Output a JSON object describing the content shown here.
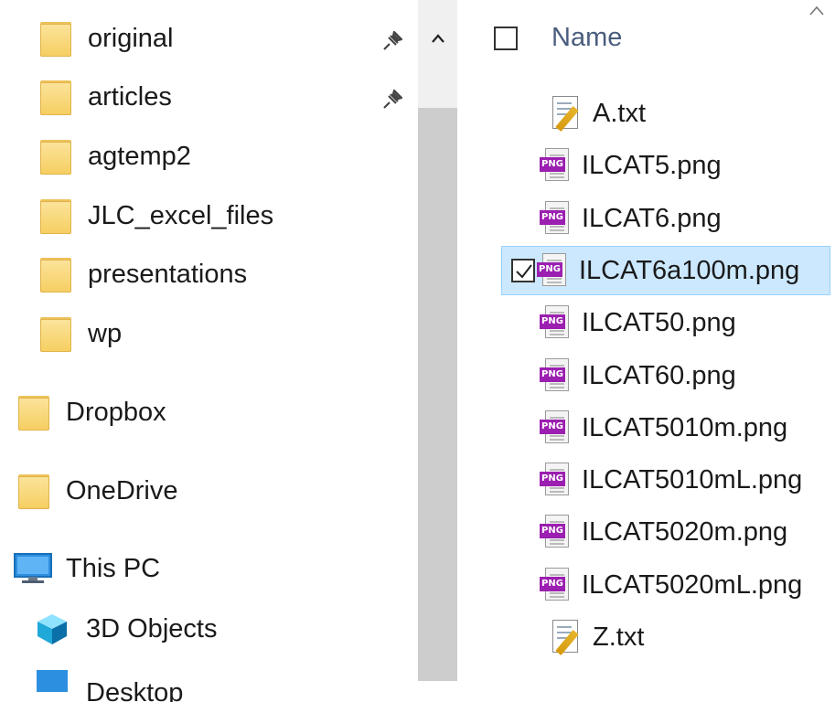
{
  "nav": {
    "pinned_folders": [
      {
        "label": "original",
        "pinned": true
      },
      {
        "label": "articles",
        "pinned": true
      },
      {
        "label": "agtemp2",
        "pinned": false
      },
      {
        "label": "JLC_excel_files",
        "pinned": false
      },
      {
        "label": "presentations",
        "pinned": false
      },
      {
        "label": "wp",
        "pinned": false
      }
    ],
    "dropbox": "Dropbox",
    "onedrive": "OneDrive",
    "this_pc": "This PC",
    "objects_3d": "3D Objects",
    "desktop_partial": "Desktop"
  },
  "header": {
    "name_column": "Name"
  },
  "files": [
    {
      "name": "A.txt",
      "type": "txt",
      "selected": false
    },
    {
      "name": "ILCAT5.png",
      "type": "png",
      "selected": false
    },
    {
      "name": "ILCAT6.png",
      "type": "png",
      "selected": false
    },
    {
      "name": "ILCAT6a100m.png",
      "type": "png",
      "selected": true
    },
    {
      "name": "ILCAT50.png",
      "type": "png",
      "selected": false
    },
    {
      "name": "ILCAT60.png",
      "type": "png",
      "selected": false
    },
    {
      "name": "ILCAT5010m.png",
      "type": "png",
      "selected": false
    },
    {
      "name": "ILCAT5010mL.png",
      "type": "png",
      "selected": false
    },
    {
      "name": "ILCAT5020m.png",
      "type": "png",
      "selected": false
    },
    {
      "name": "ILCAT5020mL.png",
      "type": "png",
      "selected": false
    },
    {
      "name": "Z.txt",
      "type": "txt",
      "selected": false
    }
  ],
  "icons": {
    "folder": "folder-icon",
    "pin": "pin-icon",
    "pc": "computer-icon",
    "cube": "3d-objects-icon",
    "png_badge": "PNG",
    "txt": "text-file-icon"
  },
  "colors": {
    "selection_bg": "#cce8ff",
    "selection_border": "#99d1ff",
    "png_badge": "#9b1fb0",
    "folder": "#f6cf62"
  }
}
